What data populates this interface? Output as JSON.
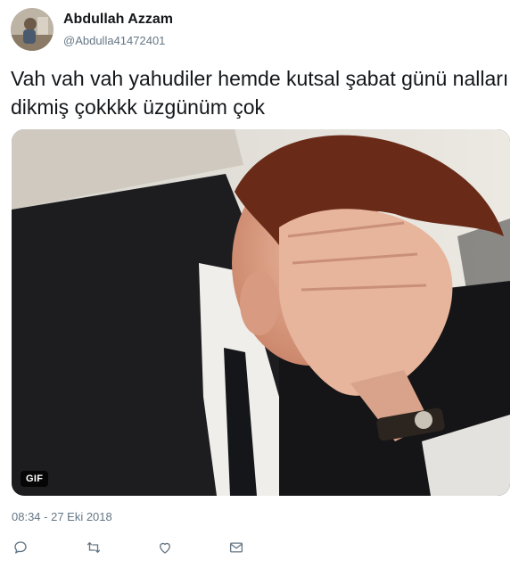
{
  "user": {
    "display_name": "Abdullah Azzam",
    "handle": "@Abdulla41472401"
  },
  "tweet": {
    "text": "Vah vah vah yahudiler hemde kutsal şabat günü nalları dikmiş çokkkk üzgünüm çok",
    "media_badge": "GIF",
    "timestamp": "08:34 - 27 Eki 2018"
  },
  "actions": [
    {
      "icon": "reply-icon"
    },
    {
      "icon": "retweet-icon"
    },
    {
      "icon": "like-icon"
    },
    {
      "icon": "dm-icon"
    }
  ],
  "colors": {
    "text_primary": "#14171a",
    "text_secondary": "#657786",
    "icon": "#657786"
  }
}
